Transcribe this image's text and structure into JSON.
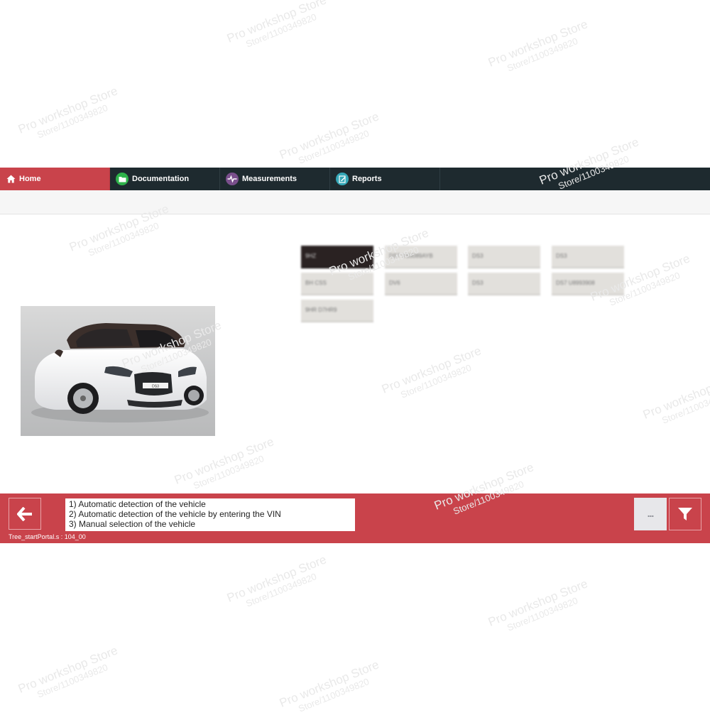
{
  "nav": {
    "tabs": [
      {
        "label": "Home",
        "icon": "home-icon",
        "active": true
      },
      {
        "label": "Documentation",
        "icon": "folder-icon",
        "color": "#2eb24a"
      },
      {
        "label": "Measurements",
        "icon": "waveform-icon",
        "color": "#7a4f8c"
      },
      {
        "label": "Reports",
        "icon": "report-icon",
        "color": "#35a8b8"
      }
    ]
  },
  "colors": {
    "accent": "#c9434b",
    "nav_background": "#1e2a2f",
    "tile_background": "#e2e0dc"
  },
  "vehicle_info": {
    "cells": [
      "9HZ",
      "DS7 VS3089AYB",
      "DS3",
      "DS3",
      "BH CSS",
      "DV6",
      "DS3",
      "DS7 U8993908",
      "9HR D7HR9"
    ]
  },
  "vehicle_photo": {
    "plate_text": "DS3"
  },
  "bottom": {
    "options": [
      "1) Automatic detection of the vehicle",
      "2) Automatic detection of the vehicle by entering the VIN",
      "3) Manual selection of the vehicle"
    ],
    "status": "Tree_startPortal.s : 104_00",
    "more_label": "..."
  },
  "watermark": {
    "line1": "Pro workshop Store",
    "line2": "Store/1100349820"
  }
}
